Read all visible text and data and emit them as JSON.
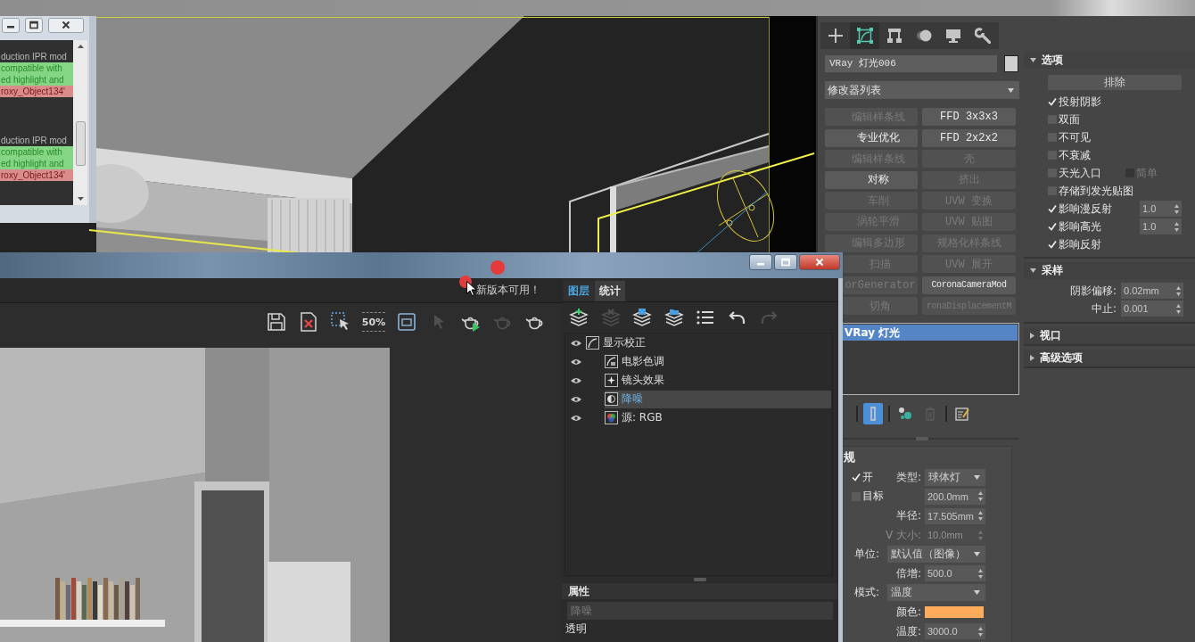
{
  "log_window": {
    "blocks": [
      [
        {
          "kind": "info",
          "text": "duction IPR mod"
        },
        {
          "kind": "ok",
          "text": "compatible with"
        },
        {
          "kind": "ok",
          "text": "ed highlight and"
        },
        {
          "kind": "error",
          "text": "roxy_Object134'"
        }
      ],
      [
        {
          "kind": "info",
          "text": "duction IPR mod"
        },
        {
          "kind": "ok",
          "text": "compatible with"
        },
        {
          "kind": "ok",
          "text": "ed highlight and"
        },
        {
          "kind": "error",
          "text": "roxy_Object134'"
        }
      ]
    ]
  },
  "command_panel": {
    "tabs": [
      {
        "kind": "create",
        "selected": false
      },
      {
        "kind": "modify",
        "selected": true
      },
      {
        "kind": "hierarchy",
        "selected": false
      },
      {
        "kind": "motion",
        "selected": false
      },
      {
        "kind": "display",
        "selected": false
      },
      {
        "kind": "utilities",
        "selected": false
      }
    ],
    "object_name": "VRay 灯光006",
    "object_swatch": {
      "color": "#d0d0d0"
    },
    "modifier_list": "修改器列表",
    "modifier_buttons": [
      {
        "label": "编辑样条线",
        "disabled": true
      },
      {
        "label": "FFD 3x3x3",
        "disabled": false
      },
      {
        "label": "专业优化",
        "disabled": false
      },
      {
        "label": "FFD 2x2x2",
        "disabled": false
      },
      {
        "label": "编辑样条线",
        "disabled": true
      },
      {
        "label": "壳",
        "disabled": true
      },
      {
        "label": "对称",
        "disabled": false
      },
      {
        "label": "挤出",
        "disabled": true
      },
      {
        "label": "车削",
        "disabled": true
      },
      {
        "label": "UVW 变换",
        "disabled": true
      },
      {
        "label": "涡轮平滑",
        "disabled": true
      },
      {
        "label": "UVW 贴图",
        "disabled": true
      },
      {
        "label": "编辑多边形",
        "disabled": true
      },
      {
        "label": "规格化样条线",
        "disabled": true
      },
      {
        "label": "扫描",
        "disabled": true
      },
      {
        "label": "UVW 展开",
        "disabled": true
      },
      {
        "label": "orGenerator",
        "disabled": true
      },
      {
        "label": "CoronaCameraMod",
        "disabled": false
      },
      {
        "label": "切角",
        "disabled": true
      },
      {
        "label": "ronaDisplacementM",
        "disabled": true
      }
    ],
    "stack": [
      {
        "label": "VRay 灯光",
        "selected": true
      }
    ],
    "stack_tools": [
      {
        "kind": "end-result",
        "selected": true,
        "disabled": false
      },
      {
        "kind": "make-unique",
        "selected": false,
        "disabled": false
      },
      {
        "kind": "remove",
        "selected": false,
        "disabled": true
      },
      {
        "kind": "configure",
        "selected": false,
        "disabled": false
      }
    ],
    "general": {
      "title": "规",
      "rows": [
        {
          "kind": "check-dropdown",
          "checked": true,
          "check_label": "开",
          "label": "类型:",
          "value": "球体灯",
          "disabled": false
        },
        {
          "kind": "check-spinner",
          "checked": false,
          "check_label": "目标",
          "value": "200.0mm",
          "disabled": false
        },
        {
          "kind": "spinner",
          "label": "半径:",
          "value": "17.505mm",
          "disabled": false
        },
        {
          "kind": "spinner",
          "label": "V 大小:",
          "value": "10.0mm",
          "disabled": true
        },
        {
          "kind": "dropdown",
          "label": "单位:",
          "value": "默认值（图像）",
          "disabled": false
        },
        {
          "kind": "spinner",
          "label": "倍增:",
          "value": "500.0",
          "disabled": false
        },
        {
          "kind": "dropdown",
          "label": "模式:",
          "value": "温度",
          "disabled": false
        },
        {
          "kind": "color",
          "label": "颜色:",
          "color": "#ffab5c",
          "disabled": false
        },
        {
          "kind": "spinner",
          "label": "温度:",
          "value": "3000.0",
          "disabled": false
        }
      ]
    }
  },
  "rollouts": [
    {
      "title": "选项",
      "expanded": true,
      "kind": "options",
      "button": "排除",
      "checks": [
        {
          "label": "投射阴影",
          "checked": true,
          "disabled": false
        },
        {
          "label": "双面",
          "checked": false,
          "disabled": false
        },
        {
          "label": "不可见",
          "checked": false,
          "disabled": false
        },
        {
          "label": "不衰减",
          "checked": false,
          "disabled": false
        },
        {
          "label": "天光入口",
          "checked": false,
          "disabled": false,
          "sub": {
            "label": "简单",
            "checked": false,
            "disabled": true
          }
        },
        {
          "label": "存储到发光贴图",
          "checked": false,
          "disabled": false
        },
        {
          "label": "影响漫反射",
          "checked": true,
          "disabled": false,
          "value": "1.0"
        },
        {
          "label": "影响高光",
          "checked": true,
          "disabled": false,
          "value": "1.0"
        },
        {
          "label": "影响反射",
          "checked": true,
          "disabled": false
        }
      ]
    },
    {
      "title": "采样",
      "expanded": true,
      "kind": "fields",
      "fields": [
        {
          "label": "阴影偏移:",
          "value": "0.02mm"
        },
        {
          "label": "中止:",
          "value": "0.001"
        }
      ]
    },
    {
      "title": "视口",
      "expanded": false
    },
    {
      "title": "高级选项",
      "expanded": false
    }
  ],
  "vfb": {
    "notice": "新版本可用！",
    "toolbar": [
      {
        "kind": "save",
        "disabled": false
      },
      {
        "kind": "clear",
        "disabled": false
      },
      {
        "kind": "region",
        "disabled": false
      },
      {
        "kind": "zoom",
        "label": "50%",
        "disabled": false
      },
      {
        "kind": "frame",
        "disabled": false
      },
      {
        "kind": "track",
        "disabled": true
      },
      {
        "kind": "start",
        "disabled": false
      },
      {
        "kind": "stop",
        "disabled": true
      },
      {
        "kind": "render",
        "disabled": false
      }
    ],
    "tabs": [
      {
        "label": "图层",
        "selected": true
      },
      {
        "label": "统计",
        "selected": false
      }
    ],
    "layer_tools": [
      {
        "kind": "add",
        "disabled": false
      },
      {
        "kind": "delete",
        "disabled": true
      },
      {
        "kind": "save",
        "disabled": false
      },
      {
        "kind": "load",
        "disabled": false
      },
      {
        "kind": "list",
        "disabled": false
      },
      {
        "kind": "undo",
        "disabled": false
      },
      {
        "kind": "redo",
        "disabled": true
      }
    ],
    "layers": [
      {
        "kind": "correction",
        "label": "显示校正",
        "selected": false,
        "children": [
          {
            "kind": "filmic",
            "label": "电影色调",
            "selected": false
          },
          {
            "kind": "lens",
            "label": "镜头效果",
            "selected": false
          },
          {
            "kind": "denoise",
            "label": "降噪",
            "selected": true
          },
          {
            "kind": "source",
            "label": "源: RGB",
            "selected": false
          }
        ]
      }
    ],
    "properties": {
      "title": "属性",
      "name": "降噪",
      "label": "透明"
    }
  }
}
